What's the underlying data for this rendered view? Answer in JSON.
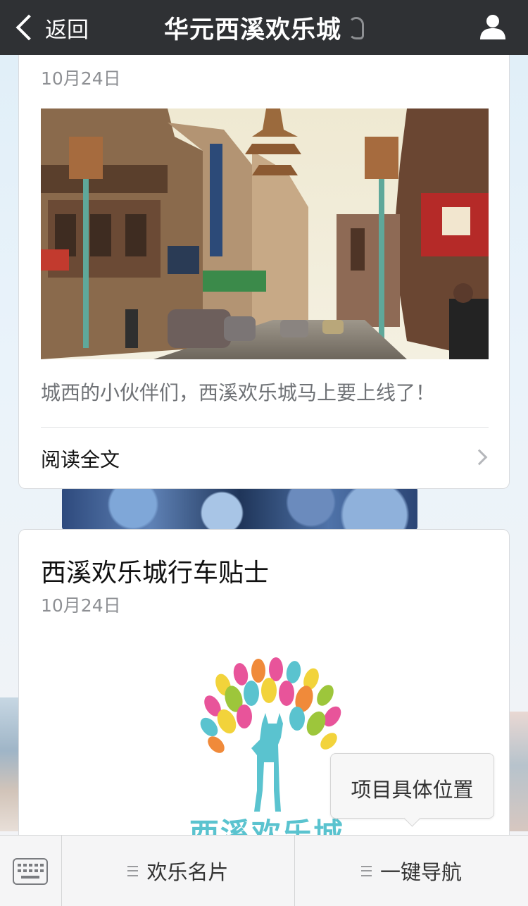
{
  "header": {
    "back_label": "返回",
    "title": "华元西溪欢乐城"
  },
  "article1": {
    "date": "10月24日",
    "description": "城西的小伙伴们，西溪欢乐城马上要上线了！",
    "read_more": "阅读全文"
  },
  "article2": {
    "title": "西溪欢乐城行车贴士",
    "date": "10月24日",
    "logo_text": "西溪欢乐城"
  },
  "popup": {
    "label": "项目具体位置"
  },
  "bottom_menu": {
    "items": [
      {
        "label": "欢乐名片"
      },
      {
        "label": "一键导航"
      }
    ]
  },
  "colors": {
    "navbar": "#2f3134",
    "logo_teal": "#5ac3cf"
  }
}
